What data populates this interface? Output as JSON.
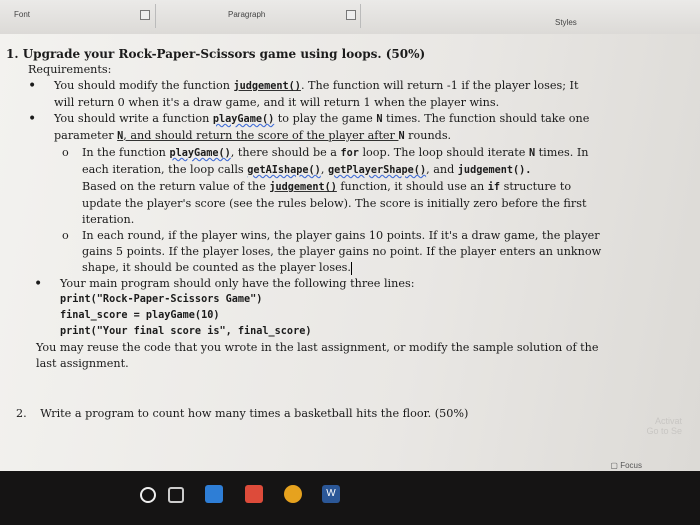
{
  "ribbon": {
    "font_label": "Font",
    "paragraph_label": "Paragraph",
    "styles_label": "Styles"
  },
  "question1": {
    "number": "1.",
    "title": "Upgrade your Rock-Paper-Scissors game using loops. (50%)",
    "requirements_label": "Requirements:",
    "req1_a": "You should modify the function ",
    "req1_func": "judgement()",
    "req1_b": ". The function will return -1 if the player loses; It",
    "req1_c": "will return 0 when it's a draw game, and it will return 1 when the player wins.",
    "req2_a": "You should write a function ",
    "req2_func": "playGame()",
    "req2_b": " to play the game ",
    "req2_N": "N",
    "req2_c": " times. The function should take one",
    "req2_d": "parameter ",
    "req2_N2": "N",
    "req2_e": ", and should return the score of the player after ",
    "req2_N3": "N",
    "req2_f": " rounds.",
    "sub1_a": "In the function ",
    "sub1_func": "playGame()",
    "sub1_b": ", there should be a ",
    "sub1_for": "for",
    "sub1_c": " loop. The loop should iterate ",
    "sub1_N": "N",
    "sub1_d": " times. In",
    "sub1_e": "each iteration, the loop calls ",
    "sub1_f1": "getAIshape()",
    "sub1_sep": ", ",
    "sub1_f2": "getPlayerShape()",
    "sub1_and": ", and ",
    "sub1_f3": "judgement().",
    "sub1_g": "Based on the return value of the ",
    "sub1_f4": "judgement()",
    "sub1_h": " function, it should use an ",
    "sub1_if": "if",
    "sub1_i": " structure to",
    "sub1_j": "update the player's score (see the rules below). The score is initially zero before the first",
    "sub1_k": "iteration.",
    "sub2_a": "In each round, if the player wins, the player gains 10 points. If it's a draw game, the player",
    "sub2_b": "gains 5 points. If the player loses, the player gains no point. If the player enters an unknow",
    "sub2_c": "shape, it should be counted as the player loses.",
    "req3": "Your main program should only have the following three lines:",
    "code1": "print(\"Rock-Paper-Scissors Game\")",
    "code2": "final_score = playGame(10)",
    "code3": "print(\"Your final score is\", final_score)",
    "reuse_a": "You may reuse the code that you wrote in the last assignment, or modify the sample solution of the",
    "reuse_b": "last assignment."
  },
  "question2": {
    "number": "2.",
    "text": "Write a program to count how many times a basketball hits the floor. (50%)"
  },
  "watermark": {
    "line1": "Activat",
    "line2": "Go to Se"
  },
  "status": {
    "focus_label": "Focus"
  },
  "taskbar": {
    "word_label": "W"
  }
}
